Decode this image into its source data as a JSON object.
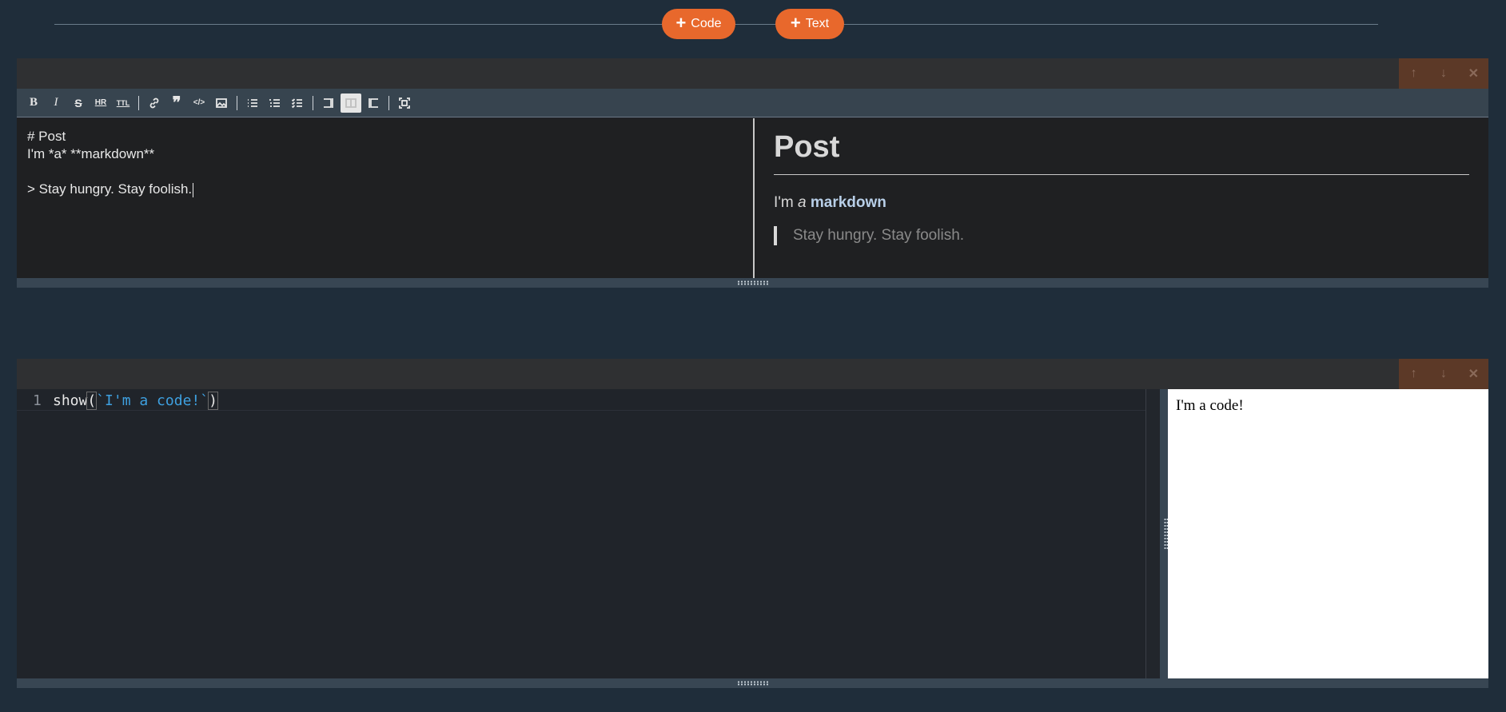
{
  "add_bar": {
    "code_label": "Code",
    "text_label": "Text",
    "accent_color": "#e8682c"
  },
  "markdown_cell": {
    "controls": {
      "up_icon": "arrow-up-icon",
      "down_icon": "arrow-down-icon",
      "close_icon": "close-icon"
    },
    "toolbar": [
      "bold",
      "italic",
      "strikethrough",
      "horizontal-rule",
      "title",
      "link",
      "quote",
      "code",
      "image",
      "unordered-list",
      "ordered-list",
      "task-list",
      "editor-only",
      "split-view",
      "preview-only",
      "fullscreen"
    ],
    "toolbar_active": "split-view",
    "editor_lines": [
      "# Post",
      "I'm *a* **markdown**",
      "",
      "> Stay hungry. Stay foolish."
    ],
    "preview": {
      "heading": "Post",
      "para_prefix": "I'm ",
      "para_em": "a",
      "para_strong": "markdown",
      "blockquote": "Stay hungry. Stay foolish."
    }
  },
  "code_cell": {
    "controls": {
      "up_icon": "arrow-up-icon",
      "down_icon": "arrow-down-icon",
      "close_icon": "close-icon"
    },
    "line_number": "1",
    "code": {
      "fn": "show",
      "open": "(",
      "string": "`I'm a code!`",
      "close": ")"
    },
    "output": "I'm a code!"
  }
}
